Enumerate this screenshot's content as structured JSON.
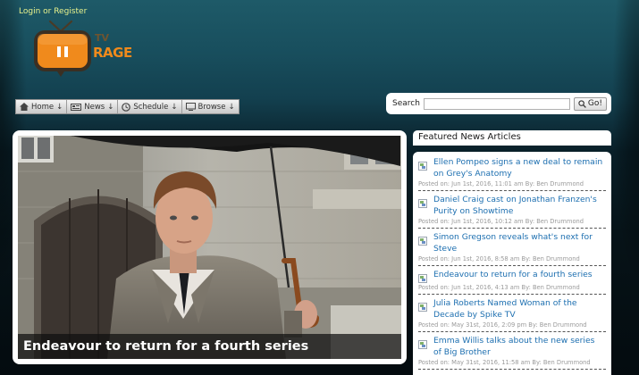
{
  "header": {
    "login_text": "Login or Register",
    "logo": {
      "brand_top": "TV",
      "brand_bottom": "RAGE",
      "icon": "tv-pause-icon"
    }
  },
  "nav": [
    {
      "label": "Home",
      "arrow": "↓",
      "icon": "home-icon"
    },
    {
      "label": "News",
      "arrow": "↓",
      "icon": "news-icon"
    },
    {
      "label": "Schedule",
      "arrow": "↓",
      "icon": "clock-icon"
    },
    {
      "label": "Browse",
      "arrow": "↓",
      "icon": "monitor-icon"
    }
  ],
  "search": {
    "label": "Search",
    "value": "",
    "button_label": "Go!",
    "button_icon": "magnifier-icon"
  },
  "feature": {
    "caption": "Endeavour to return for a fourth series",
    "image": "photo: man in grey trench coat holding a black umbrella in front of a stone building"
  },
  "news": {
    "heading": "Featured News Articles",
    "articles": [
      {
        "title": "Ellen Pompeo signs a new deal to remain on Grey's Anatomy",
        "meta": "Posted on: Jun 1st, 2016, 11:01 am By: Ben Drummond"
      },
      {
        "title": "Daniel Craig cast on Jonathan Franzen's Purity on Showtime",
        "meta": "Posted on: Jun 1st, 2016, 10:12 am By: Ben Drummond"
      },
      {
        "title": "Simon Gregson reveals what's next for Steve",
        "meta": "Posted on: Jun 1st, 2016, 8:58 am By: Ben Drummond"
      },
      {
        "title": "Endeavour to return for a fourth series",
        "meta": "Posted on: Jun 1st, 2016, 4:13 am By: Ben Drummond"
      },
      {
        "title": "Julia Roberts Named Woman of the Decade by Spike TV",
        "meta": "Posted on: May 31st, 2016, 2:09 pm By: Ben Drummond"
      },
      {
        "title": "Emma Willis talks about the new series of Big Brother",
        "meta": "Posted on: May 31st, 2016, 11:58 am By: Ben Drummond"
      }
    ]
  },
  "colors": {
    "login": "#e7f18c",
    "logo_orange": "#f08a1c",
    "link_blue": "#1d6fb0",
    "meta_grey": "#9a9a9a"
  }
}
